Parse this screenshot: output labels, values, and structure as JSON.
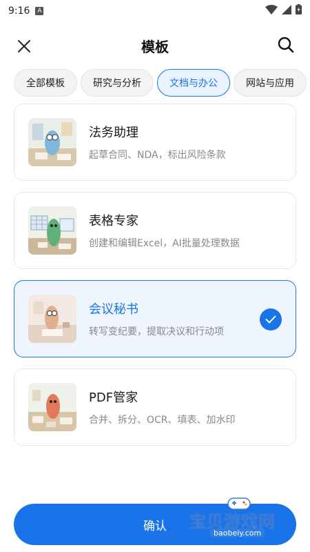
{
  "status_bar": {
    "time": "9:16",
    "notification_letter": "A"
  },
  "header": {
    "title": "模板"
  },
  "tabs": [
    {
      "label": "全部模板",
      "active": false
    },
    {
      "label": "研究与分析",
      "active": false
    },
    {
      "label": "文档与办公",
      "active": true
    },
    {
      "label": "网站与应用",
      "active": false
    }
  ],
  "cards": [
    {
      "title": "法务助理",
      "desc": "起草合同、NDA，标出风险条款",
      "selected": false,
      "thumb": "legal-assistant-illustration"
    },
    {
      "title": "表格专家",
      "desc": "创建和编辑Excel，AI批量处理数据",
      "selected": false,
      "thumb": "spreadsheet-expert-illustration"
    },
    {
      "title": "会议秘书",
      "desc": "转写变纪要，提取决议和行动项",
      "selected": true,
      "thumb": "meeting-secretary-illustration"
    },
    {
      "title": "PDF管家",
      "desc": "合并、拆分、OCR、填表、加水印",
      "selected": false,
      "thumb": "pdf-manager-illustration"
    }
  ],
  "confirm": {
    "label": "确认"
  },
  "watermark": {
    "text": "宝贝游戏网",
    "url": "baobeiy.com"
  },
  "colors": {
    "accent": "#1a73e8",
    "selected_bg": "#eef5ff"
  }
}
